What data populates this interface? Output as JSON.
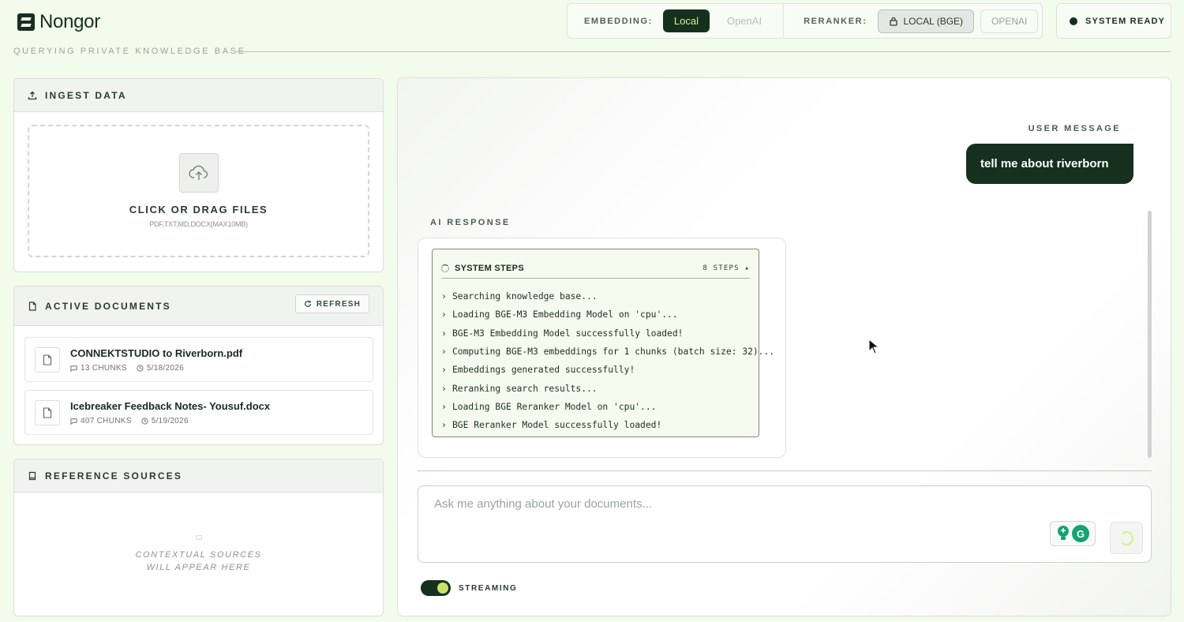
{
  "app": {
    "name": "Nongor",
    "subtitle": "Querying private knowledge base"
  },
  "config": {
    "embedding_label": "Embedding:",
    "embedding_options": [
      "Local",
      "OpenAI"
    ],
    "embedding_selected": "Local",
    "reranker_label": "Reranker:",
    "reranker_options": [
      "LOCAL (BGE)",
      "OPENAI"
    ],
    "reranker_selected": "LOCAL (BGE)"
  },
  "status": {
    "text": "SYSTEM READY",
    "color": "#16301f"
  },
  "ingest": {
    "title": "INGEST DATA",
    "drop_title": "CLICK OR DRAG FILES",
    "drop_subtitle": "PDF,TXT,MD,DOCX(MAX10MB)"
  },
  "documents": {
    "title": "ACTIVE DOCUMENTS",
    "refresh_label": "REFRESH",
    "items": [
      {
        "name": "CONNEKTSTUDIO to Riverborn.pdf",
        "chunks": "13 CHUNKS",
        "date": "5/18/2026"
      },
      {
        "name": "Icebreaker Feedback Notes- Yousuf.docx",
        "chunks": "407 CHUNKS",
        "date": "5/19/2026"
      }
    ]
  },
  "references": {
    "title": "REFERENCE SOURCES",
    "empty_line1": "CONTEXTUAL SOURCES",
    "empty_line2": "WILL APPEAR HERE"
  },
  "chat": {
    "user_label": "USER MESSAGE",
    "user_message": "tell me about riverborn",
    "ai_label": "AI RESPONSE",
    "steps_title": "SYSTEM STEPS",
    "steps_count": "8 STEPS",
    "steps": [
      "Searching knowledge base...",
      "Loading BGE-M3 Embedding Model on 'cpu'...",
      "BGE-M3 Embedding Model successfully loaded!",
      "Computing BGE-M3 embeddings for 1 chunks (batch size: 32)...",
      "Embeddings generated successfully!",
      "Reranking search results...",
      "Loading BGE Reranker Model on 'cpu'...",
      "BGE Reranker Model successfully loaded!"
    ],
    "input_placeholder": "Ask me anything about your documents...",
    "streaming_label": "STREAMING",
    "streaming_on": true
  },
  "colors": {
    "brand": "#16301f",
    "accent": "#d9ee86",
    "background": "#f3fbec"
  },
  "icons": [
    "upload-icon",
    "cloud-upload-icon",
    "file-icon",
    "refresh-icon",
    "book-icon",
    "lock-icon",
    "chunks-icon",
    "clock-icon",
    "spinner-icon",
    "chevron-right-icon",
    "grammarly-icon"
  ]
}
